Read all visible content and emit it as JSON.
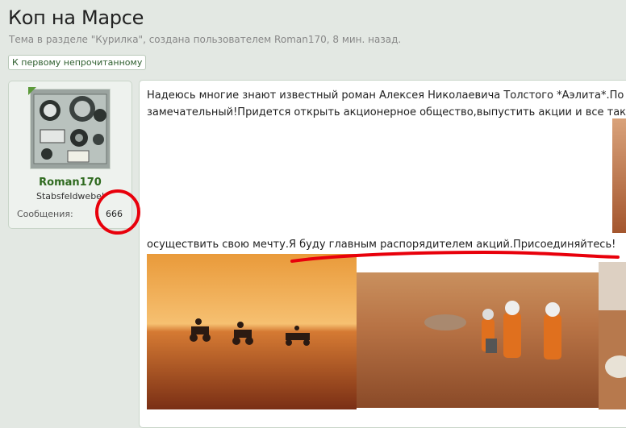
{
  "thread": {
    "title": "Коп на Марсе",
    "subtitle": "Тема в разделе \"Курилка\", создана пользователем Roman170, 8 мин. назад.",
    "unread_label": "К первому непрочитанному"
  },
  "author": {
    "name": "Roman170",
    "user_title": "Stabsfeldwebel",
    "messages_label": "Сообщения:",
    "messages_count": "666"
  },
  "post": {
    "line1": "Надеюсь многие знают известный роман Алексея Николаевича Толстого *Аэлита*.По",
    "line2": "замечательный!Придется открыть акционерное общество,выпустить акции и все тако",
    "line3": "осуществить свою мечту.Я буду главным распорядителем акций.Присоединяйтесь!"
  },
  "colors": {
    "accent_green": "#2f6a1f",
    "annotation_red": "#e8000b",
    "mars_orange": "#c8773a"
  }
}
